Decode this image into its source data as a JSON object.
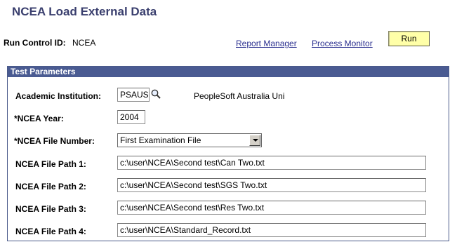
{
  "page": {
    "title": "NCEA Load External Data"
  },
  "run_control": {
    "label": "Run Control ID:",
    "value": "NCEA"
  },
  "links": {
    "report_manager": "Report Manager",
    "process_monitor": "Process Monitor"
  },
  "toolbar": {
    "run_label": "Run"
  },
  "parameters": {
    "header": "Test Parameters",
    "academic_institution": {
      "label": "Academic Institution:",
      "value": "PSAUS",
      "description": "PeopleSoft Australia Uni",
      "lookup_icon": "search-icon"
    },
    "ncea_year": {
      "label": "*NCEA Year:",
      "value": "2004"
    },
    "ncea_file_number": {
      "label": "*NCEA File Number:",
      "selected": "First Examination File"
    },
    "file_paths": [
      {
        "label": "NCEA File Path 1:",
        "value": "c:\\user\\NCEA\\Second test\\Can Two.txt"
      },
      {
        "label": "NCEA File Path 2:",
        "value": "c:\\user\\NCEA\\Second test\\SGS Two.txt"
      },
      {
        "label": "NCEA File Path 3:",
        "value": "c:\\user\\NCEA\\Second test\\Res Two.txt"
      },
      {
        "label": "NCEA File Path 4:",
        "value": "c:\\user\\NCEA\\Standard_Record.txt"
      }
    ]
  },
  "colors": {
    "header_bg": "#4a5b92",
    "title": "#3a3f6e",
    "run_button": "#ffffa8",
    "link": "#2a2f8f"
  }
}
